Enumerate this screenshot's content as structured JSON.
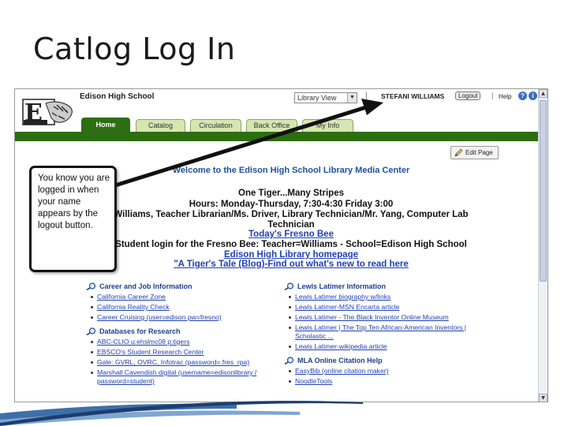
{
  "slide": {
    "title": "Catlog Log In"
  },
  "header": {
    "school_name": "Edison High School",
    "view_select_value": "Library View",
    "separator": "|",
    "user_name": "STEFANI WILLIAMS",
    "logout_label": "Logout",
    "help_separator": "|",
    "help_label": "Help",
    "help_glyph": "?",
    "info_glyph": "i"
  },
  "tabs": [
    {
      "label": "Home",
      "active": true
    },
    {
      "label": "Catalog",
      "active": false
    },
    {
      "label": "Circulation",
      "active": false
    },
    {
      "label": "Back Office",
      "active": false
    },
    {
      "label": "My Info",
      "active": false
    }
  ],
  "edit_page_label": "Edit Page",
  "main": {
    "welcome": "Welcome to the Edison High School Library Media Center",
    "tagline": "One Tiger...Many Stripes",
    "hours": "Hours: Monday-Thursday, 7:30-4:30 Friday 3:00",
    "staff_line1": "Williams, Teacher Librarian/Ms. Driver, Library Technician/Mr. Yang, Computer Lab",
    "staff_line2": "Technician",
    "link_fresno": "Today's Fresno Bee",
    "student_login": "Student login for the Fresno Bee: Teacher=Williams - School=Edison High School",
    "link_homepage": "Edison High Library homepage",
    "link_blog": "\"A Tiger's Tale (Blog)-Find out what's new to read here"
  },
  "callout": {
    "text": "You know you are logged in when your name appears by the logout button."
  },
  "sections_left": [
    {
      "heading": "Career and Job Information",
      "links": [
        "California Career Zone",
        "California Reality Check",
        "Career Cruising (user=edison pw=fresno)"
      ]
    },
    {
      "heading": "Databases for Research",
      "links": [
        "ABC-CLIO u:ehslmc08 p:tigers",
        "EBSCO's Student Research Center",
        "Gale: GVRL, OVRC, Infotrac (password= fres_rpa)",
        "Marshall Cavendish digital (username=edisonlibrary / password=student)"
      ]
    }
  ],
  "sections_right": [
    {
      "heading": "Lewis Latimer Information",
      "links": [
        "Lewis Latimer biography w/links",
        "Lewis Latimer-MSN Encarta article",
        "Lewis Latimer - The Black Inventor Online Museum",
        "Lewis Latimer | The Top Ten African-American Inventors | Scholastic ...",
        "Lewis Latimer-wikipedia article"
      ]
    },
    {
      "heading": "MLA Online Citation Help",
      "links": [
        "EasyBib (online citation maker)",
        "NoodleTools"
      ]
    }
  ],
  "colors": {
    "brand_green": "#2d6e12",
    "tab_inactive": "#d6e6b0",
    "link_blue": "#1f3fb5",
    "heading_blue": "#1f3f8e",
    "deco_blue": "#3e6fa8"
  }
}
